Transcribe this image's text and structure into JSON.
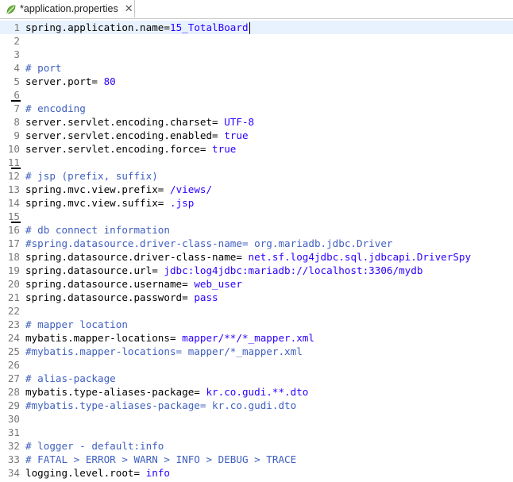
{
  "tab": {
    "title": "*application.properties",
    "close_glyph": "✕",
    "icon": "leaf-icon",
    "icon_color": "#6db33f"
  },
  "editor": {
    "lines": [
      {
        "n": "1",
        "key": "spring.application.name=",
        "val": "15_TotalBoard",
        "type": "kv",
        "current": true,
        "caret": true
      },
      {
        "n": "2",
        "type": "blank"
      },
      {
        "n": "3",
        "type": "blank"
      },
      {
        "n": "4",
        "text": "# port",
        "type": "comment"
      },
      {
        "n": "5",
        "key": "server.port= ",
        "val": "80",
        "type": "kv"
      },
      {
        "n": "6",
        "type": "blank",
        "marked": true
      },
      {
        "n": "7",
        "text": "# encoding",
        "type": "comment"
      },
      {
        "n": "8",
        "key": "server.servlet.encoding.charset= ",
        "val": "UTF-8",
        "type": "kv"
      },
      {
        "n": "9",
        "key": "server.servlet.encoding.enabled= ",
        "val": "true",
        "type": "kv"
      },
      {
        "n": "10",
        "key": "server.servlet.encoding.force= ",
        "val": "true",
        "type": "kv"
      },
      {
        "n": "11",
        "type": "blank",
        "marked": true
      },
      {
        "n": "12",
        "text": "# jsp (prefix, suffix)",
        "type": "comment"
      },
      {
        "n": "13",
        "key": "spring.mvc.view.prefix= ",
        "val": "/views/",
        "type": "kv"
      },
      {
        "n": "14",
        "key": "spring.mvc.view.suffix= ",
        "val": ".jsp",
        "type": "kv"
      },
      {
        "n": "15",
        "type": "blank",
        "marked": true
      },
      {
        "n": "16",
        "text": "# db connect information",
        "type": "comment"
      },
      {
        "n": "17",
        "text": "#spring.datasource.driver-class-name= org.mariadb.jdbc.Driver",
        "type": "comment"
      },
      {
        "n": "18",
        "key": "spring.datasource.driver-class-name= ",
        "val": "net.sf.log4jdbc.sql.jdbcapi.DriverSpy",
        "type": "kv"
      },
      {
        "n": "19",
        "key": "spring.datasource.url= ",
        "val": "jdbc:log4jdbc:mariadb://localhost:3306/mydb",
        "type": "kv"
      },
      {
        "n": "20",
        "key": "spring.datasource.username= ",
        "val": "web_user",
        "type": "kv"
      },
      {
        "n": "21",
        "key": "spring.datasource.password= ",
        "val": "pass",
        "type": "kv"
      },
      {
        "n": "22",
        "type": "blank"
      },
      {
        "n": "23",
        "text": "# mapper location",
        "type": "comment"
      },
      {
        "n": "24",
        "key": "mybatis.mapper-locations= ",
        "val": "mapper/**/*_mapper.xml",
        "type": "kv"
      },
      {
        "n": "25",
        "text": "#mybatis.mapper-locations= mapper/*_mapper.xml",
        "type": "comment"
      },
      {
        "n": "26",
        "type": "blank"
      },
      {
        "n": "27",
        "text": "# alias-package",
        "type": "comment"
      },
      {
        "n": "28",
        "key": "mybatis.type-aliases-package= ",
        "val": "kr.co.gudi.**.dto",
        "type": "kv"
      },
      {
        "n": "29",
        "text": "#mybatis.type-aliases-package= kr.co.gudi.dto",
        "type": "comment"
      },
      {
        "n": "30",
        "type": "blank"
      },
      {
        "n": "31",
        "type": "blank"
      },
      {
        "n": "32",
        "text": "# logger - default:info",
        "type": "comment"
      },
      {
        "n": "33",
        "text": "# FATAL > ERROR > WARN > INFO > DEBUG > TRACE",
        "type": "comment"
      },
      {
        "n": "34",
        "key": "logging.level.root= ",
        "val": "info",
        "type": "kv"
      }
    ]
  },
  "colors": {
    "comment": "#3f5fbf",
    "value": "#2a00ff",
    "key": "#000000",
    "current_line": "#e8f2fe"
  }
}
